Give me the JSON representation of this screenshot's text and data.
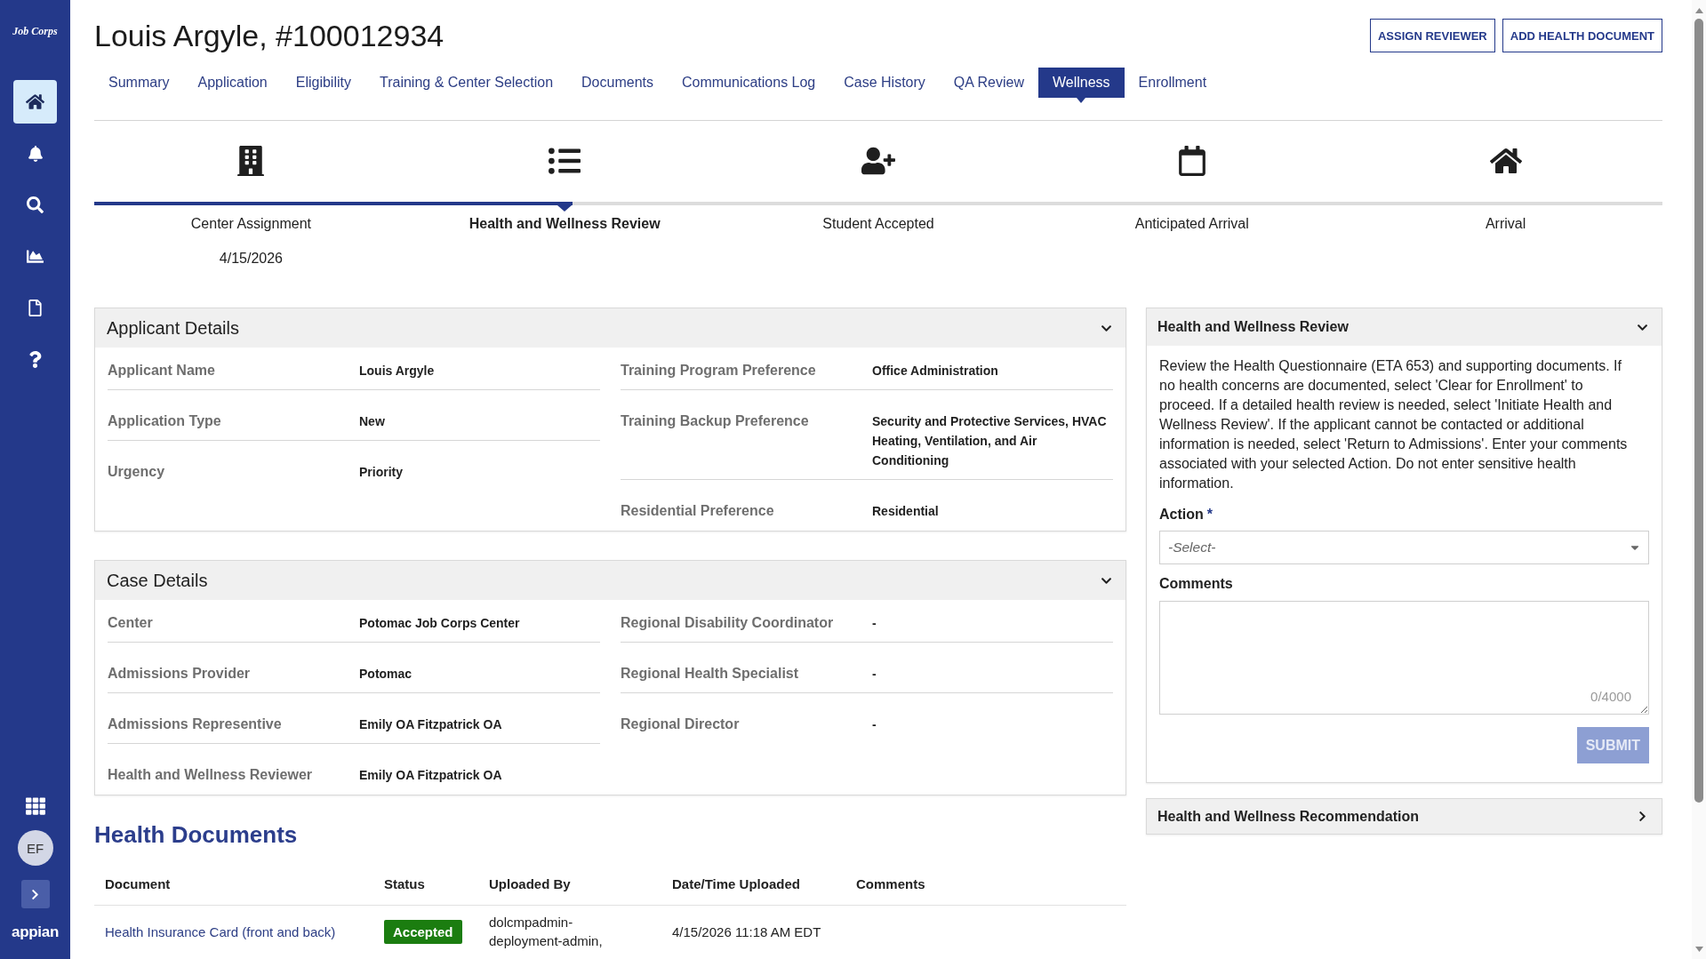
{
  "sidebar": {
    "logo": "Job Corps",
    "nav": [
      {
        "kind": "home",
        "selected": true
      },
      {
        "kind": "notifications",
        "selected": false
      },
      {
        "kind": "search",
        "selected": false
      },
      {
        "kind": "reports",
        "selected": false
      },
      {
        "kind": "documents",
        "selected": false
      },
      {
        "kind": "help",
        "selected": false
      }
    ],
    "user_initials": "EF",
    "brand": "appian"
  },
  "header": {
    "title": "Louis Argyle, #100012934",
    "buttons": [
      "ASSIGN REVIEWER",
      "ADD HEALTH DOCUMENT"
    ]
  },
  "tabs": [
    {
      "label": "Summary",
      "selected": false
    },
    {
      "label": "Application",
      "selected": false
    },
    {
      "label": "Eligibility",
      "selected": false
    },
    {
      "label": "Training & Center Selection",
      "selected": false
    },
    {
      "label": "Documents",
      "selected": false
    },
    {
      "label": "Communications Log",
      "selected": false
    },
    {
      "label": "Case History",
      "selected": false
    },
    {
      "label": "QA Review",
      "selected": false
    },
    {
      "label": "Wellness",
      "selected": true
    },
    {
      "label": "Enrollment",
      "selected": false
    }
  ],
  "milestones": [
    {
      "kind": "building",
      "label": "Center Assignment",
      "date": "4/15/2026",
      "selected": false
    },
    {
      "kind": "list",
      "label": "Health and Wellness Review",
      "selected": true
    },
    {
      "kind": "person-add",
      "label": "Student Accepted",
      "selected": false
    },
    {
      "kind": "calendar",
      "label": "Anticipated Arrival",
      "selected": false
    },
    {
      "kind": "house",
      "label": "Arrival",
      "selected": false
    }
  ],
  "applicant_details": {
    "title": "Applicant Details",
    "expanded": true,
    "columns": [
      [
        {
          "label": "Applicant Name",
          "value": "Louis Argyle"
        },
        {
          "label": "Application Type",
          "value": "New"
        },
        {
          "label": "Urgency",
          "value": "Priority"
        }
      ],
      [
        {
          "label": "Training Program Preference",
          "value": "Office Administration"
        },
        {
          "label": "Training Backup Preference",
          "value": "Security and Protective Services, HVAC Heating, Ventilation, and Air Conditioning"
        },
        {
          "label": "Residential Preference",
          "value": "Residential"
        }
      ]
    ]
  },
  "case_details": {
    "title": "Case Details",
    "expanded": true,
    "columns": [
      [
        {
          "label": "Center",
          "value": "Potomac Job Corps Center"
        },
        {
          "label": "Admissions Provider",
          "value": "Potomac"
        },
        {
          "label": "Admissions Representive",
          "value": "Emily OA Fitzpatrick OA"
        },
        {
          "label": "Health and Wellness Reviewer",
          "value": "Emily OA Fitzpatrick OA"
        }
      ],
      [
        {
          "label": "Regional Disability Coordinator",
          "value": "-"
        },
        {
          "label": "Regional Health Specialist",
          "value": "-"
        },
        {
          "label": "Regional Director",
          "value": "-"
        }
      ]
    ]
  },
  "health_documents": {
    "title": "Health Documents",
    "columns": [
      "Document",
      "Status",
      "Uploaded By",
      "Date/Time Uploaded",
      "Comments"
    ],
    "rows": [
      {
        "document": "Health Insurance Card (front and back)",
        "status": "Accepted",
        "uploaded_by": "dolcmpadmin-deployment-admin,",
        "uploaded_at": "4/15/2026 11:18 AM EDT"
      }
    ]
  },
  "review": {
    "title": "Health and Wellness Review",
    "expanded": true,
    "instructions": "Review the Health Questionnaire (ETA 653) and supporting documents. If no health concerns are documented, select 'Clear for Enrollment' to proceed. If a detailed health review is needed, select 'Initiate Health and Wellness Review'. If the applicant cannot be contacted or additional information is needed, select 'Return to Admissions'. Enter your comments associated with your selected Action. Do not enter sensitive health information.",
    "action": {
      "label": "Action",
      "required_mark": "*",
      "placeholder": "-Select-"
    },
    "comments": {
      "label": "Comments",
      "counter": "0/4000"
    },
    "submit": {
      "label": "SUBMIT",
      "disabled": true
    }
  },
  "recommendation": {
    "title": "Health and Wellness Recommendation",
    "expanded": false
  }
}
